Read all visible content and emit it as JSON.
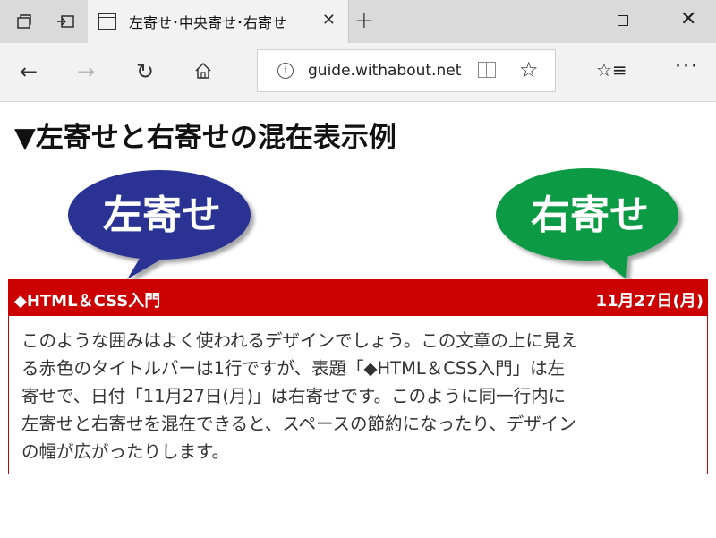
{
  "browser": {
    "tab_title": "左寄せ･中央寄せ･右寄せ",
    "tab_close": "✕",
    "new_tab": "+",
    "url": "guide.withabout.net",
    "icons": [
      "tab-manager-icon",
      "set-aside-tabs-icon",
      "page-icon",
      "close-icon",
      "plus-icon",
      "minimize-icon",
      "maximize-icon",
      "back-icon",
      "forward-icon",
      "refresh-icon",
      "home-icon",
      "info-icon",
      "reading-view-icon",
      "favorite-star-icon",
      "favorites-hub-icon",
      "more-icon"
    ]
  },
  "page": {
    "heading": "▼左寄せと右寄せの混在表示例",
    "bubble_left": {
      "label": "左寄せ",
      "color": "#2b3394"
    },
    "bubble_right": {
      "label": "右寄せ",
      "color": "#0a9a45"
    },
    "box": {
      "title": "◆HTML＆CSS入門",
      "date": "11月27日(月)",
      "accent": "#cc0000",
      "lines": [
        "このような囲みはよく使われるデザインでしょう。この文章の上に見え",
        "る赤色のタイトルバーは1行ですが、表題「◆HTML＆CSS入門」は左",
        "寄せで、日付「11月27日(月)」は右寄せです。このように同一行内に",
        "左寄せと右寄せを混在できると、スペースの節約になったり、デザイン",
        "の幅が広がったりします。"
      ]
    }
  }
}
